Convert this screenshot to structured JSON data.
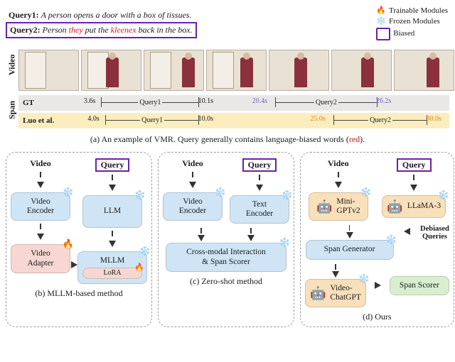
{
  "legend": {
    "trainable": "Trainable Modules",
    "frozen": "Frozen Modules",
    "biased": "Biased"
  },
  "queries": {
    "q1_label": "Query1",
    "q1_text": "A person opens a door with a box of tissues.",
    "q2_label": "Query2",
    "q2_text_pre": "Person ",
    "q2_red1": "they",
    "q2_mid": " put the ",
    "q2_red2": "kleenex",
    "q2_post": " back in the box."
  },
  "side": {
    "video": "Video",
    "span": "Span"
  },
  "spans": {
    "gt_label": "GT",
    "luo_label": "Luo et al.",
    "gt": {
      "q1_start": "3.6s",
      "q1_end": "10.1s",
      "q1_text": "Query1",
      "q2_start": "20.4s",
      "q2_end": "26.2s",
      "q2_text": "Query2"
    },
    "luo": {
      "q1_start": "4.0s",
      "q1_end": "10.0s",
      "q1_text": "Query1",
      "q2_start": "25.0s",
      "q2_end": "30.0s",
      "q2_text": "Query2"
    }
  },
  "captions": {
    "a_pre": "(a) An example of VMR. Query generally contains language-biased words (",
    "a_red": "red",
    "a_post": ").",
    "b": "(b) MLLM-based method",
    "c": "(c) Zero-shot method",
    "d": "(d) Ours"
  },
  "labels": {
    "video": "Video",
    "query": "Query",
    "video_encoder": "Video\nEncoder",
    "llm": "LLM",
    "video_adapter": "Video\nAdapter",
    "mllm": "MLLM",
    "lora": "LoRA",
    "text_encoder": "Text\nEncoder",
    "cmi": "Cross-modal Interaction\n& Span Scorer",
    "minigpt": "Mini-\nGPTv2",
    "llama": "LLaMA-3",
    "span_gen": "Span Generator",
    "debiased": "Debiased\nQueries",
    "vcgpt": "Video-\nChatGPT",
    "span_scorer": "Span Scorer"
  },
  "icons": {
    "fire": "🔥",
    "snow": "❄️",
    "robot": "🤖"
  }
}
